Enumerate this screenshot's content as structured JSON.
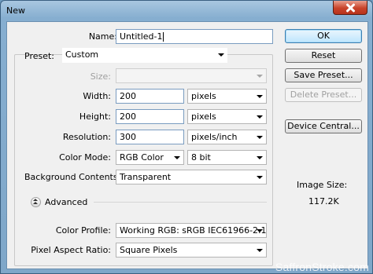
{
  "window": {
    "title": "New"
  },
  "form": {
    "name_label": "Name:",
    "name_value": "Untitled-1",
    "preset_label": "Preset:",
    "preset_value": "Custom",
    "size_label": "Size:",
    "size_value": "",
    "width_label": "Width:",
    "width_value": "200",
    "width_unit": "pixels",
    "height_label": "Height:",
    "height_value": "200",
    "height_unit": "pixels",
    "resolution_label": "Resolution:",
    "resolution_value": "300",
    "resolution_unit": "pixels/inch",
    "color_mode_label": "Color Mode:",
    "color_mode_value": "RGB Color",
    "bit_depth_value": "8 bit",
    "background_label": "Background Contents:",
    "background_value": "Transparent",
    "advanced_label": "Advanced",
    "color_profile_label": "Color Profile:",
    "color_profile_value": "Working RGB:  sRGB IEC61966-2.1",
    "pixel_aspect_label": "Pixel Aspect Ratio:",
    "pixel_aspect_value": "Square Pixels"
  },
  "buttons": {
    "ok": "OK",
    "reset": "Reset",
    "save_preset": "Save Preset...",
    "delete_preset": "Delete Preset...",
    "device_central": "Device Central..."
  },
  "info": {
    "image_size_label": "Image Size:",
    "image_size_value": "117.2K"
  },
  "watermark": "SaffronStroke.com"
}
